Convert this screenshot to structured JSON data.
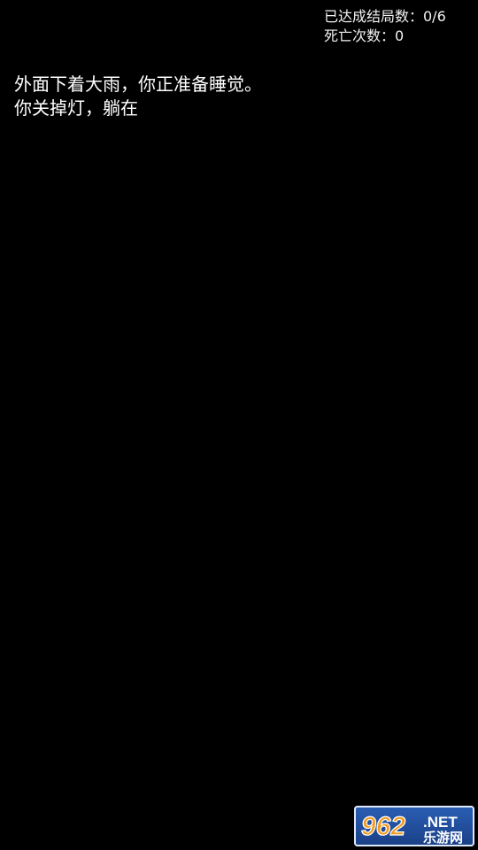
{
  "stats": {
    "endings_label": "已达成结局数：0/6",
    "deaths_label": "死亡次数：0"
  },
  "story": {
    "lines": [
      "外面下着大雨，你正准备睡觉。",
      "你关掉灯，躺在"
    ]
  },
  "watermark": {
    "brand_number": "962",
    "brand_suffix": ".NET",
    "brand_subtitle": "乐游网"
  }
}
